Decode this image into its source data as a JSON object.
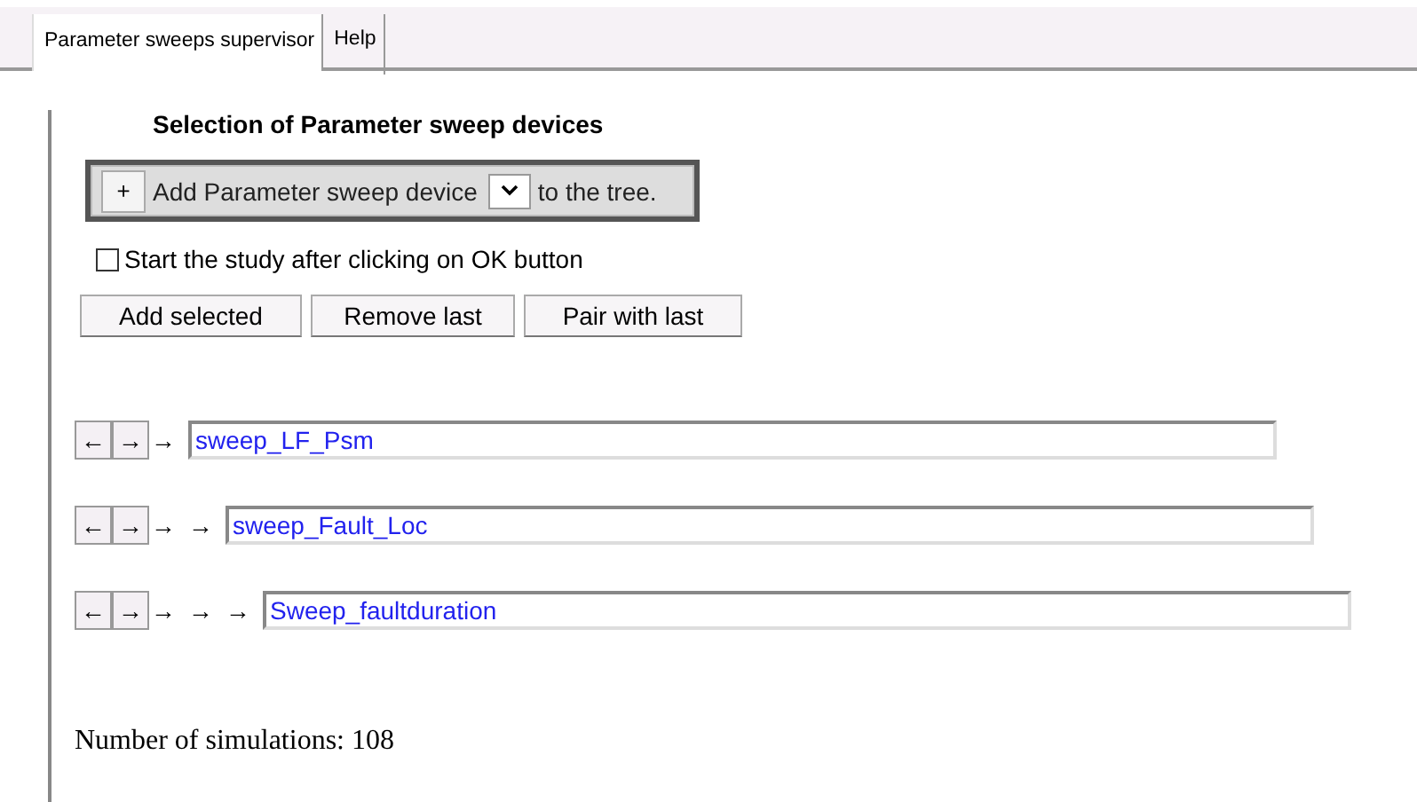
{
  "tabs": [
    {
      "label": "Parameter sweeps supervisor",
      "selected": true
    },
    {
      "label": "Help",
      "selected": false
    }
  ],
  "heading": "Selection of Parameter sweep devices",
  "add_bar": {
    "plus": "+",
    "label_before": "Add Parameter sweep device",
    "label_after": "to the tree."
  },
  "start_checkbox": {
    "label": "Start the study after clicking on OK button",
    "checked": false
  },
  "buttons": [
    "Add selected",
    "Remove last",
    "Pair with last"
  ],
  "sweeps": [
    {
      "left": "←",
      "right": "→",
      "arrows": [
        "→"
      ],
      "value": "sweep_LF_Psm"
    },
    {
      "left": "←",
      "right": "→",
      "arrows": [
        "→",
        "→"
      ],
      "value": "sweep_Fault_Loc"
    },
    {
      "left": "←",
      "right": "→",
      "arrows": [
        "→",
        "→",
        "→"
      ],
      "value": "Sweep_faultduration"
    }
  ],
  "summary": "Number of simulations: 108"
}
